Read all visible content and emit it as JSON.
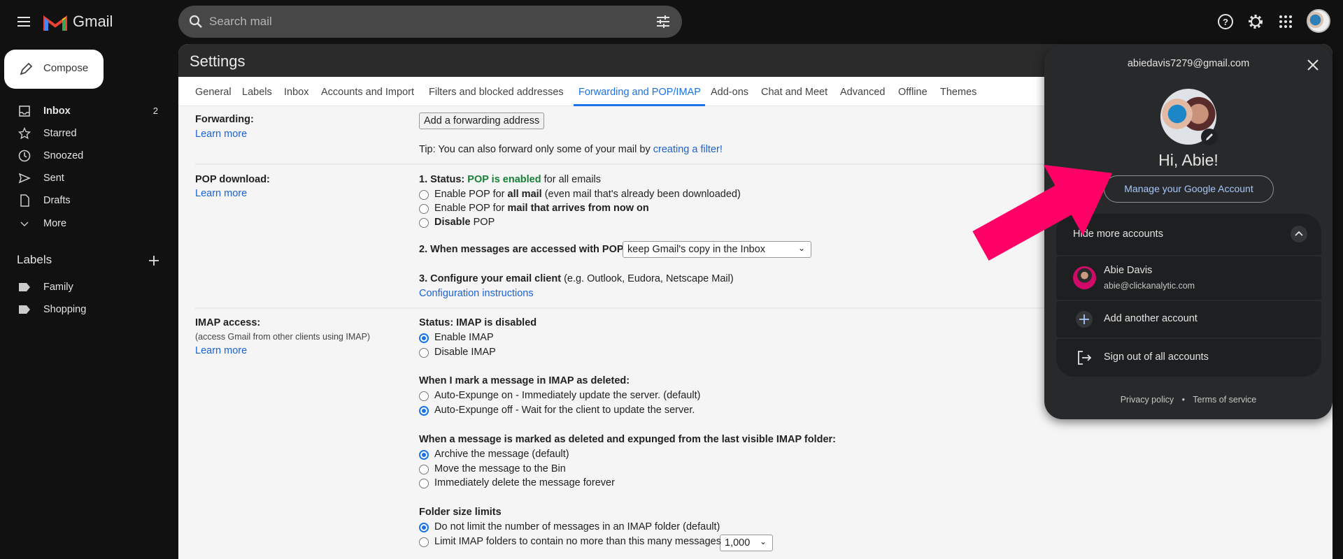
{
  "app": {
    "name": "Gmail",
    "brand_colors": [
      "#ea4335",
      "#4285f4",
      "#34a853",
      "#fbbc04"
    ]
  },
  "search": {
    "placeholder": "Search mail"
  },
  "header_icons": [
    "menu-icon",
    "search-icon",
    "filter-options-icon",
    "help-icon",
    "settings-gear-icon",
    "apps-grid-icon",
    "account-avatar"
  ],
  "sidebar": {
    "compose": "Compose",
    "items": [
      {
        "label": "Inbox",
        "count": "2",
        "icon": "inbox-icon"
      },
      {
        "label": "Starred",
        "icon": "star-icon"
      },
      {
        "label": "Snoozed",
        "icon": "clock-icon"
      },
      {
        "label": "Sent",
        "icon": "send-icon"
      },
      {
        "label": "Drafts",
        "icon": "draft-icon"
      },
      {
        "label": "More",
        "icon": "chevron-down-icon"
      }
    ],
    "labels_title": "Labels",
    "labels": [
      {
        "label": "Family"
      },
      {
        "label": "Shopping"
      }
    ]
  },
  "settings": {
    "title": "Settings",
    "tabs": [
      "General",
      "Labels",
      "Inbox",
      "Accounts and Import",
      "Filters and blocked addresses",
      "Forwarding and POP/IMAP",
      "Add-ons",
      "Chat and Meet",
      "Advanced",
      "Offline",
      "Themes"
    ],
    "active_tab": "Forwarding and POP/IMAP",
    "forwarding": {
      "label": "Forwarding:",
      "learn_more": "Learn more",
      "button": "Add a forwarding address",
      "tip": "Tip: You can also forward only some of your mail by ",
      "tip_link": "creating a filter!"
    },
    "pop": {
      "label": "POP download:",
      "learn_more": "Learn more",
      "status_prefix": "1. Status: ",
      "status_value": "POP is enabled",
      "status_suffix": " for all emails",
      "options": [
        {
          "pre": "Enable POP for ",
          "bold": "all mail",
          "post": " (even mail that's already been downloaded)",
          "checked": false
        },
        {
          "pre": "Enable POP for ",
          "bold": "mail that arrives from now on",
          "post": "",
          "checked": false
        },
        {
          "pre": "",
          "bold": "Disable",
          "post": " POP",
          "checked": false
        }
      ],
      "when_accessed": "2. When messages are accessed with POP",
      "when_accessed_value": "keep Gmail's copy in the Inbox",
      "configure": "3. Configure your email client",
      "configure_note": " (e.g. Outlook, Eudora, Netscape Mail)",
      "config_link": "Configuration instructions"
    },
    "imap": {
      "label": "IMAP access:",
      "note": "(access Gmail from other clients using IMAP)",
      "learn_more": "Learn more",
      "status": "Status: IMAP is disabled",
      "access_options": [
        {
          "label": "Enable IMAP",
          "checked": true
        },
        {
          "label": "Disable IMAP",
          "checked": false
        }
      ],
      "deleted_title": "When I mark a message in IMAP as deleted:",
      "deleted_options": [
        {
          "label": "Auto-Expunge on - Immediately update the server. (default)",
          "checked": false
        },
        {
          "label": "Auto-Expunge off - Wait for the client to update the server.",
          "checked": true
        }
      ],
      "expunged_title": "When a message is marked as deleted and expunged from the last visible IMAP folder:",
      "expunged_options": [
        {
          "label": "Archive the message (default)",
          "checked": true
        },
        {
          "label": "Move the message to the Bin",
          "checked": false
        },
        {
          "label": "Immediately delete the message forever",
          "checked": false
        }
      ],
      "folder_title": "Folder size limits",
      "folder_options": [
        {
          "label": "Do not limit the number of messages in an IMAP folder (default)",
          "checked": true
        },
        {
          "label": "Limit IMAP folders to contain no more than this many messages",
          "checked": false
        }
      ],
      "folder_limit_value": "1,000"
    }
  },
  "account_panel": {
    "email": "abiedavis7279@gmail.com",
    "greeting": "Hi, Abie!",
    "manage": "Manage your Google Account",
    "hide_accounts": "Hide more accounts",
    "other_account": {
      "name": "Abie Davis",
      "email": "abie@clickanalytic.com"
    },
    "add_account": "Add another account",
    "sign_out": "Sign out of all accounts",
    "privacy": "Privacy policy",
    "separator": "•",
    "terms": "Terms of service"
  },
  "annotation": {
    "arrow_color": "#ff0066"
  }
}
